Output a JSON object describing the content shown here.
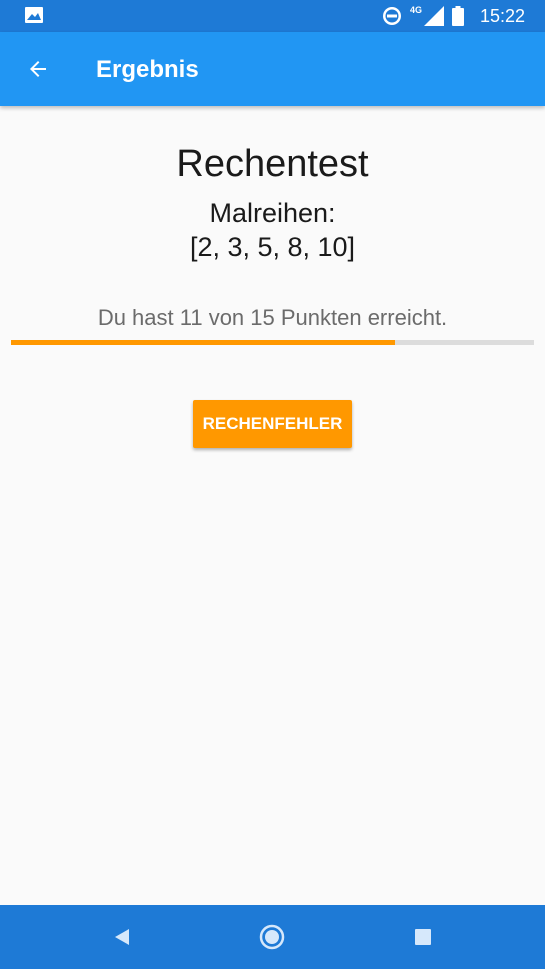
{
  "status_bar": {
    "time": "15:22",
    "network_label": "4G",
    "icons": [
      "image-icon",
      "do-not-disturb-icon",
      "signal-icon",
      "battery-icon"
    ]
  },
  "app_bar": {
    "title": "Ergebnis",
    "back_icon": "arrow-back-icon",
    "color": "#2196f3"
  },
  "content": {
    "title": "Rechentest",
    "subtitle_line1": "Malreihen:",
    "subtitle_line2": "[2, 3, 5, 8, 10]",
    "result_text": "Du hast 11 von 15 Punkten erreicht.",
    "progress": {
      "value": 11,
      "max": 15,
      "color": "#ff9800"
    },
    "button_label": "RECHENFEHLER",
    "button_color": "#ff9800"
  },
  "nav_bar": {
    "icons": [
      "back-triangle-icon",
      "home-circle-icon",
      "recents-square-icon"
    ]
  }
}
